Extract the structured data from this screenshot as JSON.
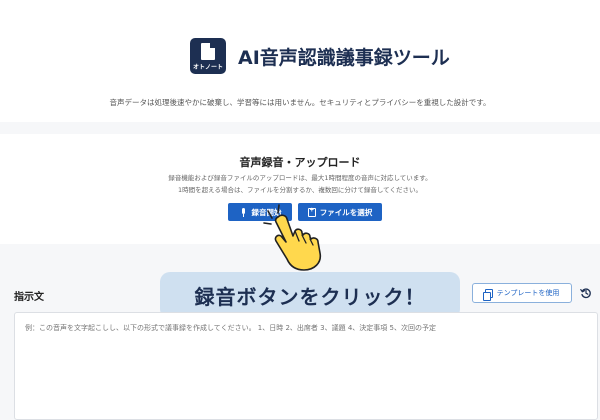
{
  "header": {
    "logo_text": "オトノート",
    "title": "AI音声認識議事録ツール",
    "description": "音声データは処理後速やかに破棄し、学習等には用いません。セキュリティとプライバシーを重視した設計です。"
  },
  "upload": {
    "title": "音声録音・アップロード",
    "desc_line1": "録音機能および録音ファイルのアップロードは、最大1時間程度の音声に対応しています。",
    "desc_line2": "1時間を超える場合は、ファイルを分割するか、複数回に分けて録音してください。",
    "record_label": "録音開始",
    "file_label": "ファイルを選択"
  },
  "instructions": {
    "label": "指示文",
    "template_label": "テンプレートを使用",
    "placeholder": "例：この音声を文字起こしし、以下の形式で議事録を作成してください。 1、日時 2、出席者 3、議題 4、決定事項 5、次回の予定"
  },
  "callout": {
    "text": "録音ボタンをクリック！"
  },
  "icons": {
    "record": "mic-icon",
    "file": "file-plus-icon",
    "template": "copy-icon",
    "history": "history-icon",
    "pointer": "pointing-hand-icon"
  },
  "colors": {
    "brand": "#1d2f52",
    "button": "#1e63c4",
    "callout_bg": "#cfe0f0",
    "hand": "#ffd84d"
  }
}
